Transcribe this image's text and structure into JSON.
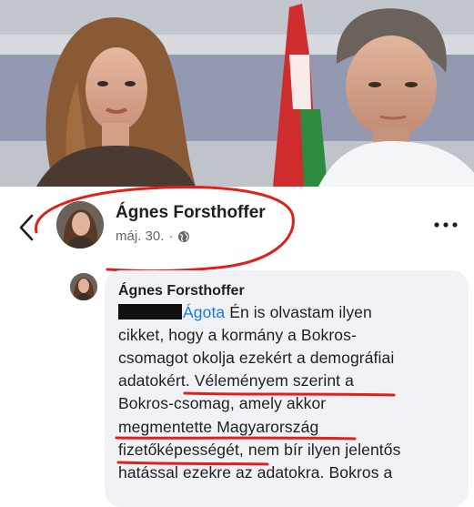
{
  "post": {
    "author_name": "Ágnes Forsthoffer",
    "date": "máj. 30.",
    "separator": "·"
  },
  "icons": {
    "back": "chevron-left-icon",
    "more": "more-options-icon",
    "audience": "globe-icon"
  },
  "comment": {
    "author_name": "Ágnes Forsthoffer",
    "mention": "Ágota",
    "lines": {
      "l1_after_mention": " Én is olvastam ilyen",
      "l2": "cikket, hogy a kormány a Bokros-",
      "l3": "csomagot okolja ezekért a demográfiai",
      "l4": "adatokért. Véleményem szerint a",
      "l5": "Bokros-csomag, amely akkor",
      "l6": "megmentette Magyarország",
      "l7": "fizetőképességét, nem bír ilyen jelentős",
      "l8": "hatással ezekre az adatokra. Bokros a"
    }
  },
  "colors": {
    "annotation_red": "#e0201b",
    "mention_blue": "#1877f2",
    "bubble_bg": "#f0f2f5",
    "meta_gray": "#65676b"
  }
}
